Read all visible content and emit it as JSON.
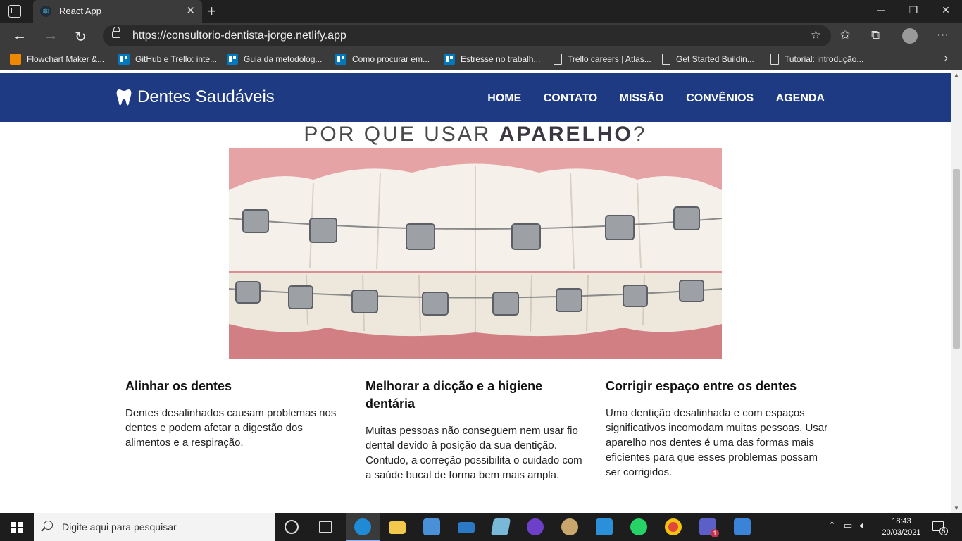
{
  "browser": {
    "tab_title": "React App",
    "url": "https://consultorio-dentista-jorge.netlify.app",
    "bookmarks": [
      {
        "label": "Flowchart Maker &...",
        "icon": "flowchart-icon"
      },
      {
        "label": "GitHub e Trello: inte...",
        "icon": "trello-icon"
      },
      {
        "label": "Guia da metodolog...",
        "icon": "trello-icon"
      },
      {
        "label": "Como procurar em...",
        "icon": "trello-icon"
      },
      {
        "label": "Estresse no trabalh...",
        "icon": "trello-icon"
      },
      {
        "label": "Trello careers | Atlas...",
        "icon": "page-icon"
      },
      {
        "label": "Get Started Buildin...",
        "icon": "page-icon"
      },
      {
        "label": "Tutorial: introdução...",
        "icon": "page-icon"
      }
    ]
  },
  "site": {
    "brand": "Dentes Saudáveis",
    "nav": [
      "HOME",
      "CONTATO",
      "MISSÃO",
      "CONVÊNIOS",
      "AGENDA"
    ],
    "section_title_prefix": "POR QUE USAR ",
    "section_title_strong": "APARELHO",
    "section_title_suffix": "?",
    "cards": [
      {
        "title": "Alinhar os dentes",
        "text": "Dentes desalinhados causam problemas nos dentes e podem afetar a digestão dos alimentos e a respiração."
      },
      {
        "title": "Melhorar a dicção e a higiene dentária",
        "text": "Muitas pessoas não conseguem nem usar fio dental devido à posição da sua dentição. Contudo, a correção possibilita o cuidado com a saúde bucal de forma bem mais ampla."
      },
      {
        "title": "Corrigir espaço entre os dentes",
        "text": "Uma dentição desalinhada e com espaços significativos incomodam muitas pessoas. Usar aparelho nos dentes é uma das formas mais eficientes para que esses problemas possam ser corrigidos."
      }
    ]
  },
  "taskbar": {
    "search_placeholder": "Digite aqui para pesquisar",
    "time": "18:43",
    "date": "20/03/2021",
    "notification_count": "5",
    "teams_badge": "1"
  }
}
